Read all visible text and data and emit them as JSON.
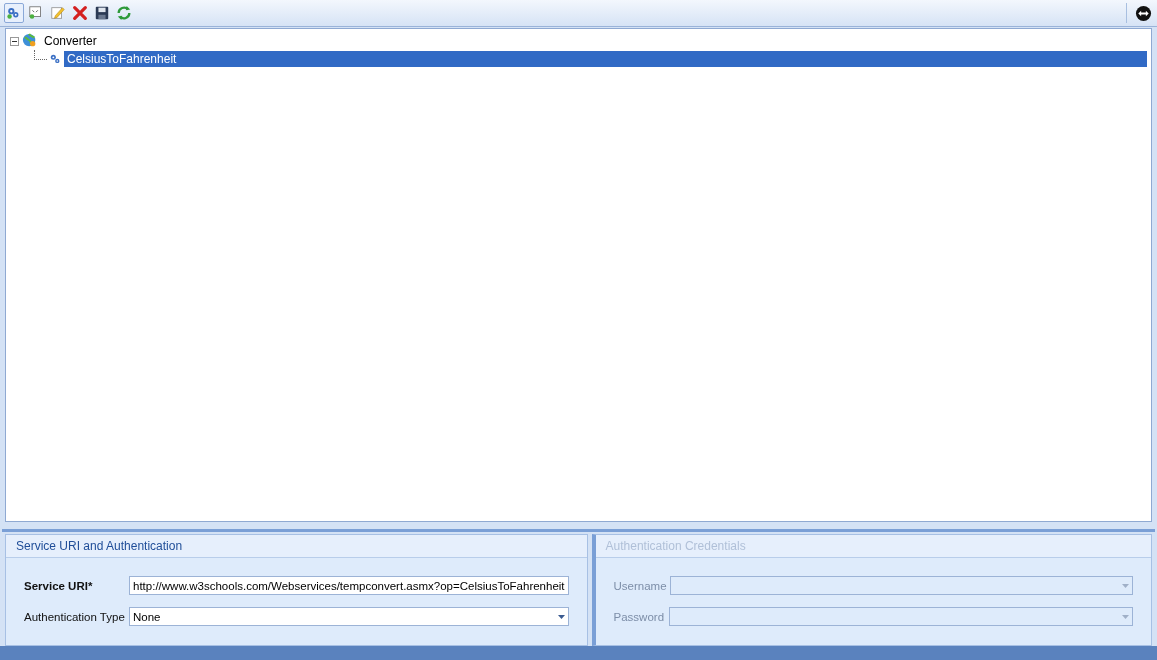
{
  "toolbar": {
    "buttons": [
      {
        "kind": "add-service",
        "selected": true
      },
      {
        "kind": "add-operation",
        "selected": false
      },
      {
        "kind": "edit",
        "selected": false
      },
      {
        "kind": "delete",
        "selected": false
      },
      {
        "kind": "save",
        "selected": false
      },
      {
        "kind": "refresh",
        "selected": false
      }
    ],
    "right_button": {
      "kind": "swap"
    }
  },
  "tree": [
    {
      "label": "Converter",
      "kind": "service",
      "expanded": true,
      "selected": false,
      "children": [
        {
          "label": "CelsiusToFahrenheit",
          "kind": "operation",
          "selected": true
        }
      ]
    }
  ],
  "service_panel": {
    "title": "Service URI and Authentication",
    "disabled": false,
    "fields": [
      {
        "label": "Service URI*",
        "kind": "text",
        "bold": true,
        "value": "http://www.w3schools.com/Webservices/tempconvert.asmx?op=CelsiusToFahrenheit"
      },
      {
        "label": "Authentication Type",
        "kind": "dropdown",
        "bold": false,
        "value": "None"
      }
    ]
  },
  "credentials_panel": {
    "title": "Authentication Credentials",
    "disabled": true,
    "fields": [
      {
        "label": "Username",
        "kind": "dropdown",
        "bold": false
      },
      {
        "label": "Password",
        "kind": "dropdown",
        "bold": false
      }
    ]
  }
}
